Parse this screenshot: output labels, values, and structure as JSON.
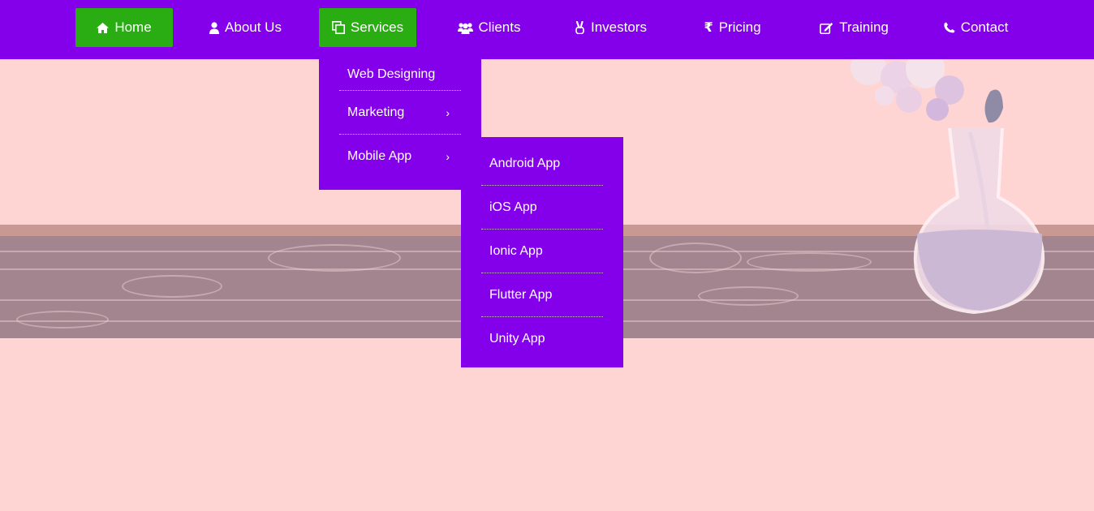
{
  "nav": {
    "items": [
      {
        "label": "Home",
        "icon": "home-icon"
      },
      {
        "label": "About Us",
        "icon": "user-icon"
      },
      {
        "label": "Services",
        "icon": "copy-icon"
      },
      {
        "label": "Clients",
        "icon": "users-icon"
      },
      {
        "label": "Investors",
        "icon": "hand-peace-icon"
      },
      {
        "label": "Pricing",
        "icon": "rupee-icon"
      },
      {
        "label": "Training",
        "icon": "edit-icon"
      },
      {
        "label": "Contact",
        "icon": "phone-icon"
      }
    ]
  },
  "services_menu": {
    "items": [
      {
        "label": "Web Designing"
      },
      {
        "label": "Marketing",
        "submenu_indicator": "›"
      },
      {
        "label": "Mobile App",
        "submenu_indicator": "›"
      }
    ]
  },
  "mobile_app_menu": {
    "items": [
      {
        "label": "Android App"
      },
      {
        "label": "iOS App"
      },
      {
        "label": "Ionic App"
      },
      {
        "label": "Flutter App"
      },
      {
        "label": "Unity App"
      }
    ]
  },
  "colors": {
    "navbar": "#8400ea",
    "active": "#2aad13",
    "background": "#ffd5d3",
    "shelf": "#a3858f"
  }
}
